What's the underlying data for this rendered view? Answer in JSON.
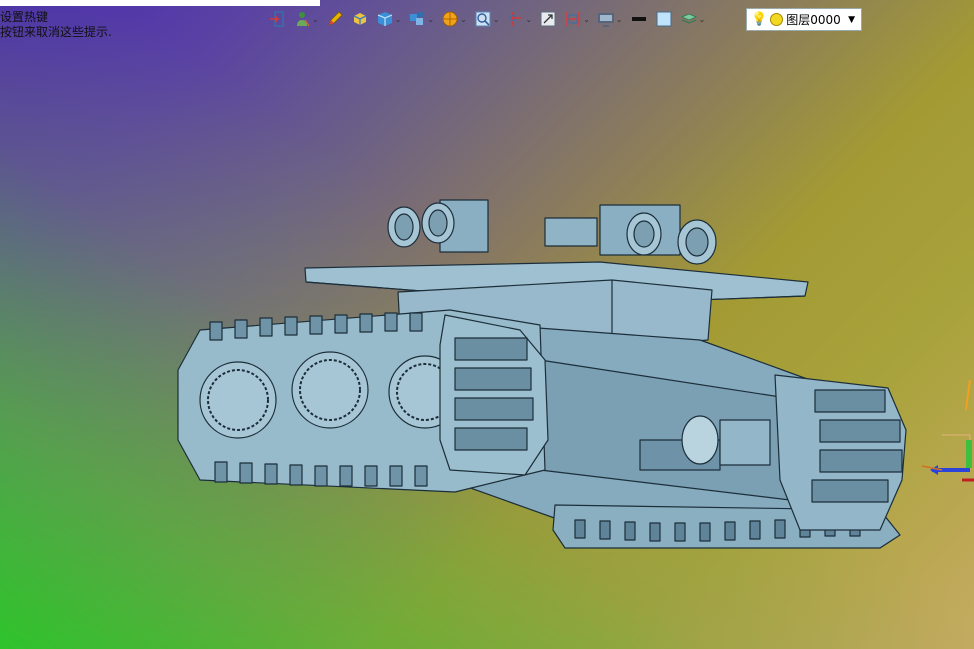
{
  "hint": {
    "line1": "设置热键",
    "line2": "按钮来取消这些提示."
  },
  "toolbar": {
    "items": [
      {
        "icon": "exit-door-icon",
        "color": "#d03a3a"
      },
      {
        "icon": "select-person-icon",
        "color": "#3f8f3f"
      },
      {
        "icon": "pencil-icon",
        "color": "#d9a300"
      },
      {
        "icon": "solid-box-icon",
        "color": "#3a8fd6"
      },
      {
        "icon": "cube-icon",
        "color": "#2f7fc8"
      },
      {
        "icon": "view-orientation-icon",
        "color": "#3a8fd6"
      },
      {
        "icon": "render-sphere-icon",
        "color": "#e08b00"
      },
      {
        "icon": "zoom-view-icon",
        "color": "#5a83b8"
      },
      {
        "icon": "axis-icon",
        "color": "#d03a3a"
      },
      {
        "icon": "scale-icon",
        "color": "#5c6c7c"
      },
      {
        "icon": "section-view-icon",
        "color": "#d04040"
      },
      {
        "icon": "monitor-icon",
        "color": "#55667a"
      },
      {
        "icon": "line-weight-icon",
        "color": "#111111"
      },
      {
        "icon": "color-swatch-icon",
        "color": "#bfe3f8"
      },
      {
        "icon": "layers-icon",
        "color": "#4aa36a"
      }
    ]
  },
  "layer": {
    "label": "图层0000"
  },
  "colors": {
    "model_fill": "#8fb4c7",
    "model_edge": "#1c2e3a",
    "bg_purple": "#4a2bb0",
    "bg_olive": "#a9a33c",
    "bg_green": "#2ac828"
  }
}
